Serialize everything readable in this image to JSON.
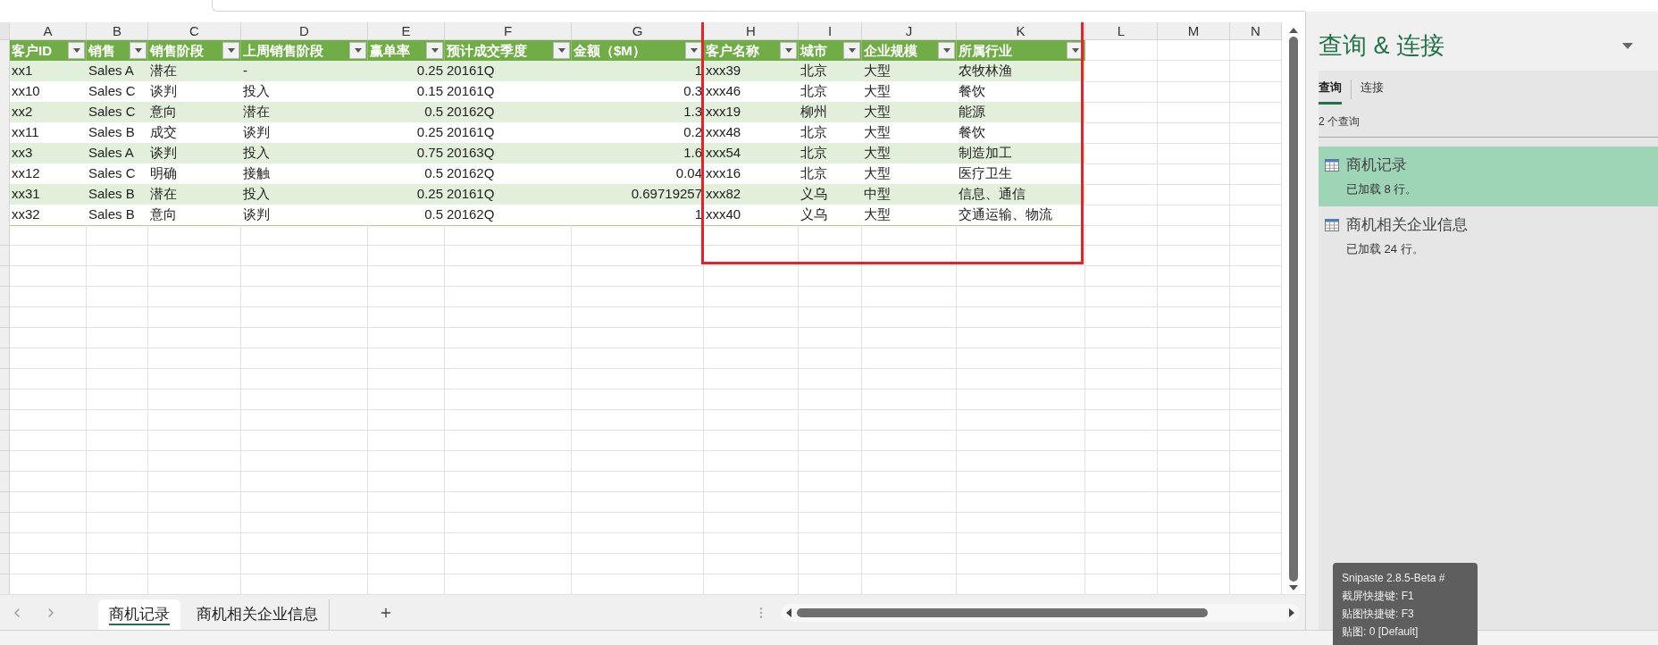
{
  "column_letters": [
    "A",
    "B",
    "C",
    "D",
    "E",
    "F",
    "G",
    "H",
    "I",
    "J",
    "K",
    "L",
    "M",
    "N"
  ],
  "table": {
    "columns": [
      {
        "label": "客户ID",
        "kind": "text"
      },
      {
        "label": "销售",
        "kind": "text"
      },
      {
        "label": "销售阶段",
        "kind": "text"
      },
      {
        "label": "上周销售阶段",
        "kind": "text"
      },
      {
        "label": "赢单率",
        "kind": "number"
      },
      {
        "label": "预计成交季度",
        "kind": "text"
      },
      {
        "label": "金额（$M）",
        "kind": "number"
      },
      {
        "label": "客户名称",
        "kind": "text"
      },
      {
        "label": "城市",
        "kind": "text"
      },
      {
        "label": "企业规模",
        "kind": "text"
      },
      {
        "label": "所属行业",
        "kind": "text"
      }
    ],
    "rows": [
      {
        "cells": [
          "xx1",
          "Sales A",
          "潜在",
          "-",
          "0.25",
          "20161Q",
          "1",
          "xxx39",
          "北京",
          "大型",
          "农牧林渔"
        ]
      },
      {
        "cells": [
          "xx10",
          "Sales C",
          "谈判",
          "投入",
          "0.15",
          "20161Q",
          "0.3",
          "xxx46",
          "北京",
          "大型",
          "餐饮"
        ]
      },
      {
        "cells": [
          "xx2",
          "Sales C",
          "意向",
          "潜在",
          "0.5",
          "20162Q",
          "1.3",
          "xxx19",
          "柳州",
          "大型",
          "能源"
        ]
      },
      {
        "cells": [
          "xx11",
          "Sales B",
          "成交",
          "谈判",
          "0.25",
          "20161Q",
          "0.2",
          "xxx48",
          "北京",
          "大型",
          "餐饮"
        ]
      },
      {
        "cells": [
          "xx3",
          "Sales A",
          "谈判",
          "投入",
          "0.75",
          "20163Q",
          "1.6",
          "xxx54",
          "北京",
          "大型",
          "制造加工"
        ]
      },
      {
        "cells": [
          "xx12",
          "Sales C",
          "明确",
          "接触",
          "0.5",
          "20162Q",
          "0.04",
          "xxx16",
          "北京",
          "大型",
          "医疗卫生"
        ]
      },
      {
        "cells": [
          "xx31",
          "Sales B",
          "潜在",
          "投入",
          "0.25",
          "20161Q",
          "0.69719257",
          "xxx82",
          "义乌",
          "中型",
          "信息、通信"
        ]
      },
      {
        "cells": [
          "xx32",
          "Sales B",
          "意向",
          "谈判",
          "0.5",
          "20162Q",
          "1",
          "xxx40",
          "义乌",
          "大型",
          "交通运输、物流"
        ]
      }
    ]
  },
  "sheet_tabs": [
    {
      "label": "商机记录",
      "selected": true
    },
    {
      "label": "商机相关企业信息",
      "selected": false
    }
  ],
  "panel": {
    "title": "查询 & 连接",
    "tabs": [
      {
        "label": "查询",
        "selected": true
      },
      {
        "label": "连接",
        "selected": false
      }
    ],
    "count": "2 个查询",
    "queries": [
      {
        "name": "商机记录",
        "status": "已加载 8 行。",
        "selected": true
      },
      {
        "name": "商机相关企业信息",
        "status": "已加载 24 行。",
        "selected": false
      }
    ]
  },
  "tooltip": {
    "lines": [
      "Snipaste 2.8.5-Beta #",
      "截屏快捷键: F1",
      "贴图快捷键: F3",
      "贴图: 0 [Default]"
    ]
  }
}
